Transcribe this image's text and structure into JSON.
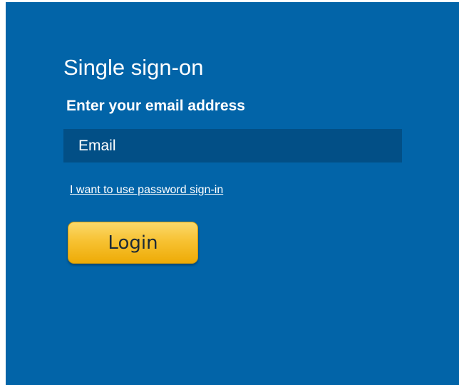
{
  "sso": {
    "title": "Single sign-on",
    "subtitle": "Enter your email address",
    "email_placeholder": "Email",
    "email_value": "",
    "password_link": "I want to use password sign-in",
    "login_label": "Login"
  },
  "colors": {
    "panel_background": "#0264a8",
    "input_background": "#024f86",
    "button_gradient_top": "#fbd96b",
    "button_gradient_bottom": "#eeab06",
    "text": "#ffffff"
  }
}
